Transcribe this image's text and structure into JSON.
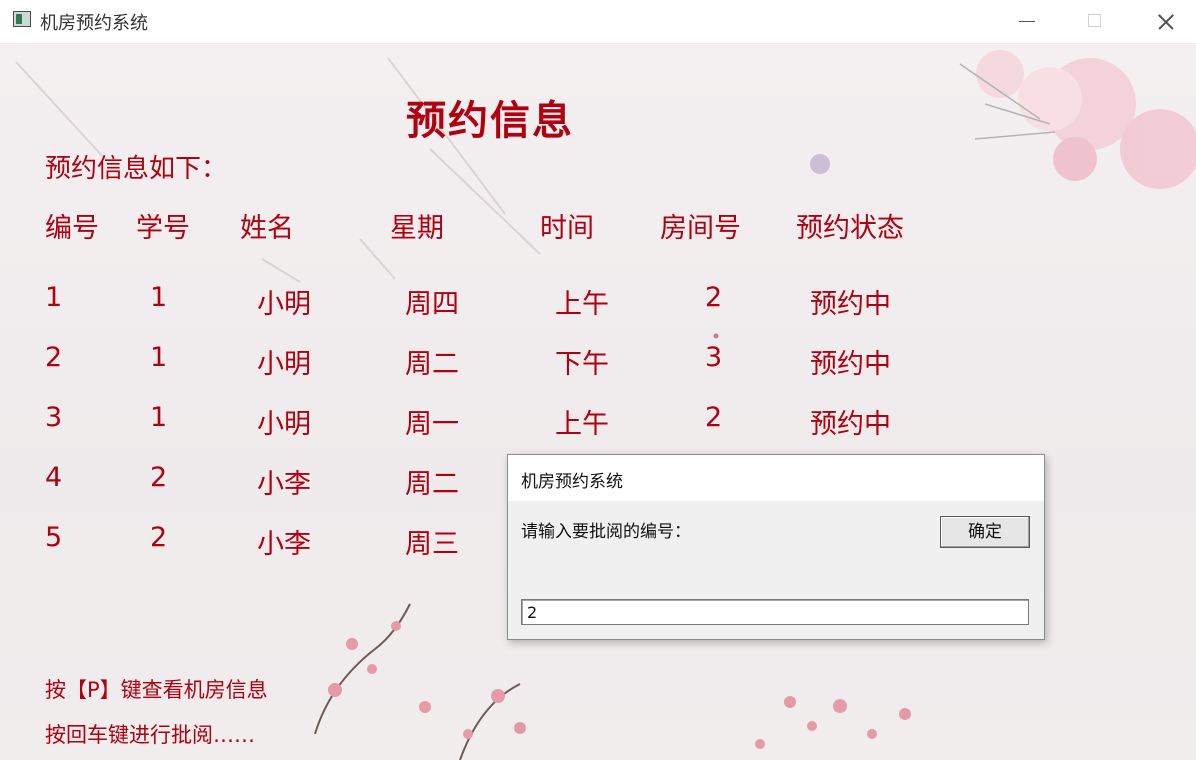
{
  "window": {
    "title": "机房预约系统"
  },
  "page": {
    "title": "预约信息",
    "subtitle": "预约信息如下：",
    "headers": [
      "编号",
      "学号",
      "姓名",
      "星期",
      "时间",
      "房间号",
      "预约状态"
    ],
    "rows": [
      [
        "1",
        "1",
        "小明",
        "周四",
        "上午",
        "2",
        "预约中"
      ],
      [
        "2",
        "1",
        "小明",
        "周二",
        "下午",
        "3",
        "预约中"
      ],
      [
        "3",
        "1",
        "小明",
        "周一",
        "上午",
        "2",
        "预约中"
      ],
      [
        "4",
        "2",
        "小李",
        "周二"
      ],
      [
        "5",
        "2",
        "小李",
        "周三"
      ]
    ],
    "footer": [
      "按【P】键查看机房信息",
      "按回车键进行批阅……"
    ]
  },
  "dialog": {
    "title": "机房预约系统",
    "prompt": "请输入要批阅的编号：",
    "ok_label": "确定",
    "input_value": "2"
  },
  "colors": {
    "text_red": "#b1000f",
    "dialog_bg": "#f0f0f0"
  }
}
